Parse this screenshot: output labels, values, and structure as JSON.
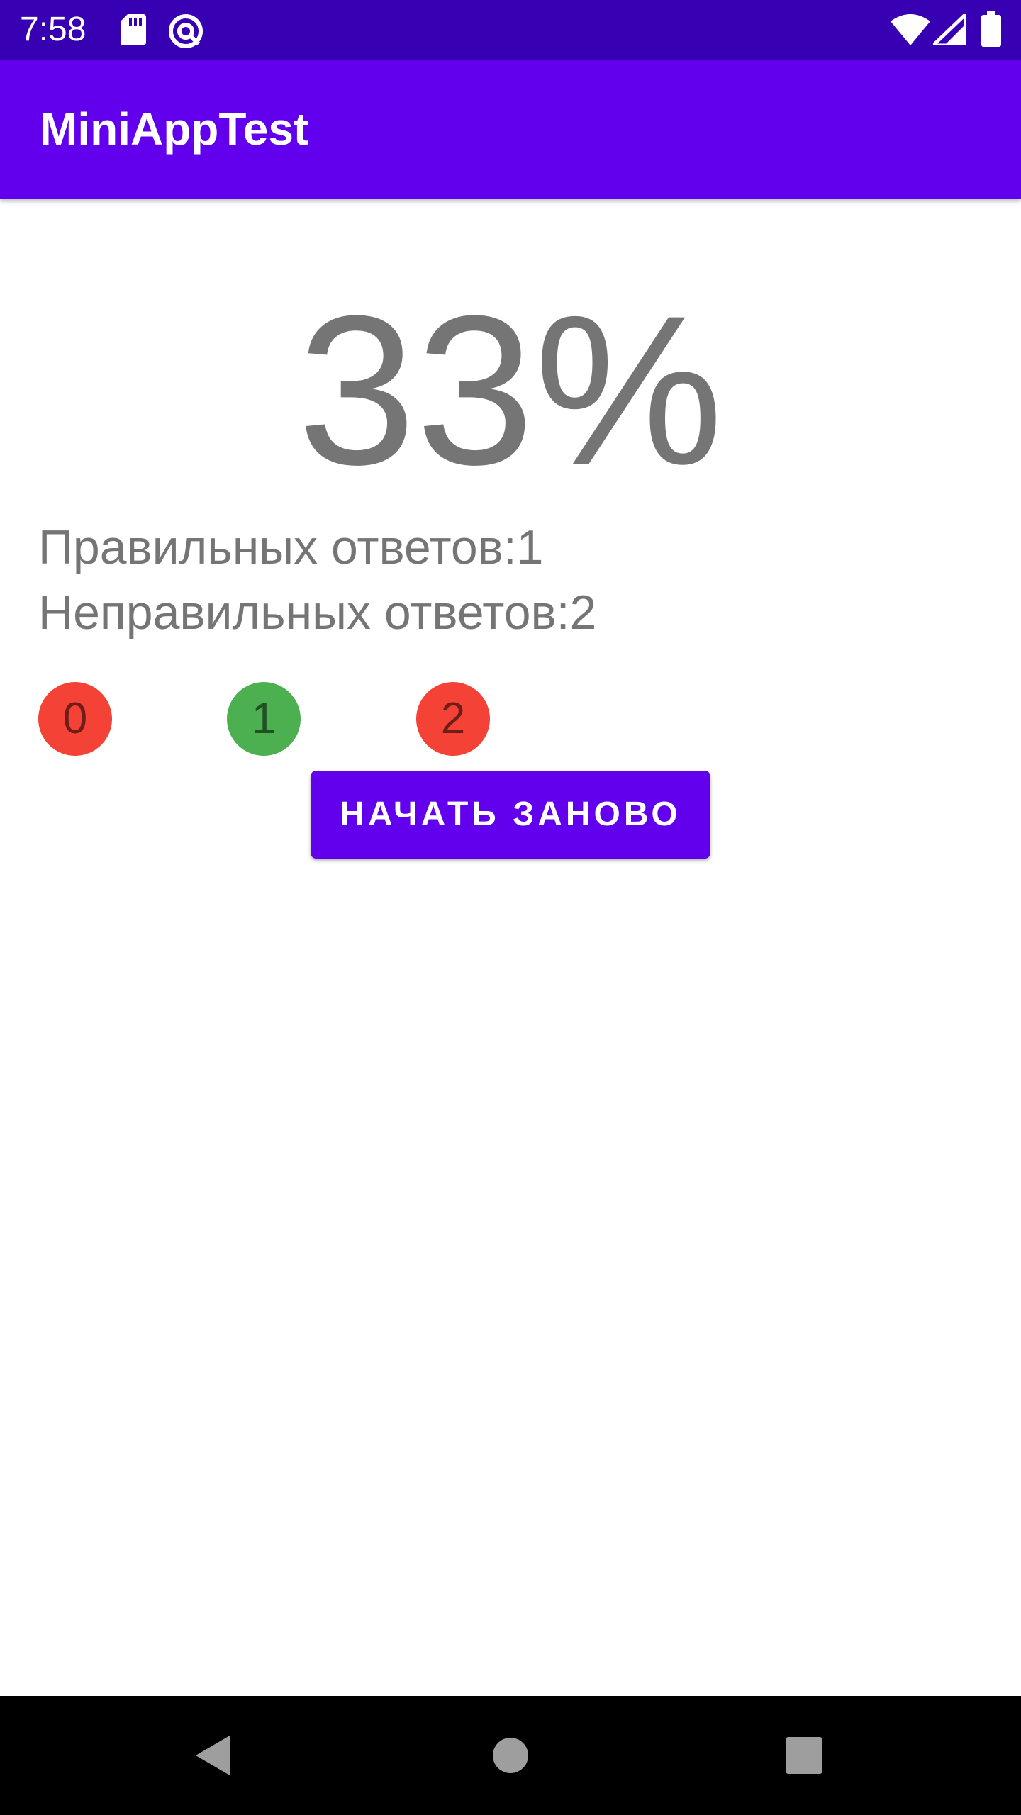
{
  "status_bar": {
    "time": "7:58",
    "icons": [
      "sd-card-icon",
      "sync-icon",
      "wifi-icon",
      "signal-icon",
      "battery-icon"
    ]
  },
  "app_bar": {
    "title": "MiniAppTest",
    "color": "#6200ee"
  },
  "result": {
    "percent": "33%",
    "correct_label": "Правильных ответов:1",
    "incorrect_label": "Неправильных ответов:2"
  },
  "answers": [
    {
      "label": "0",
      "status": "incorrect",
      "color": "#f44336"
    },
    {
      "label": "1",
      "status": "correct",
      "color": "#4caf50"
    },
    {
      "label": "2",
      "status": "incorrect",
      "color": "#f44336"
    }
  ],
  "restart_button": {
    "label": "НАЧАТЬ ЗАНОВО"
  },
  "nav_bar": {
    "icons": [
      "back-icon",
      "home-icon",
      "recents-icon"
    ]
  }
}
